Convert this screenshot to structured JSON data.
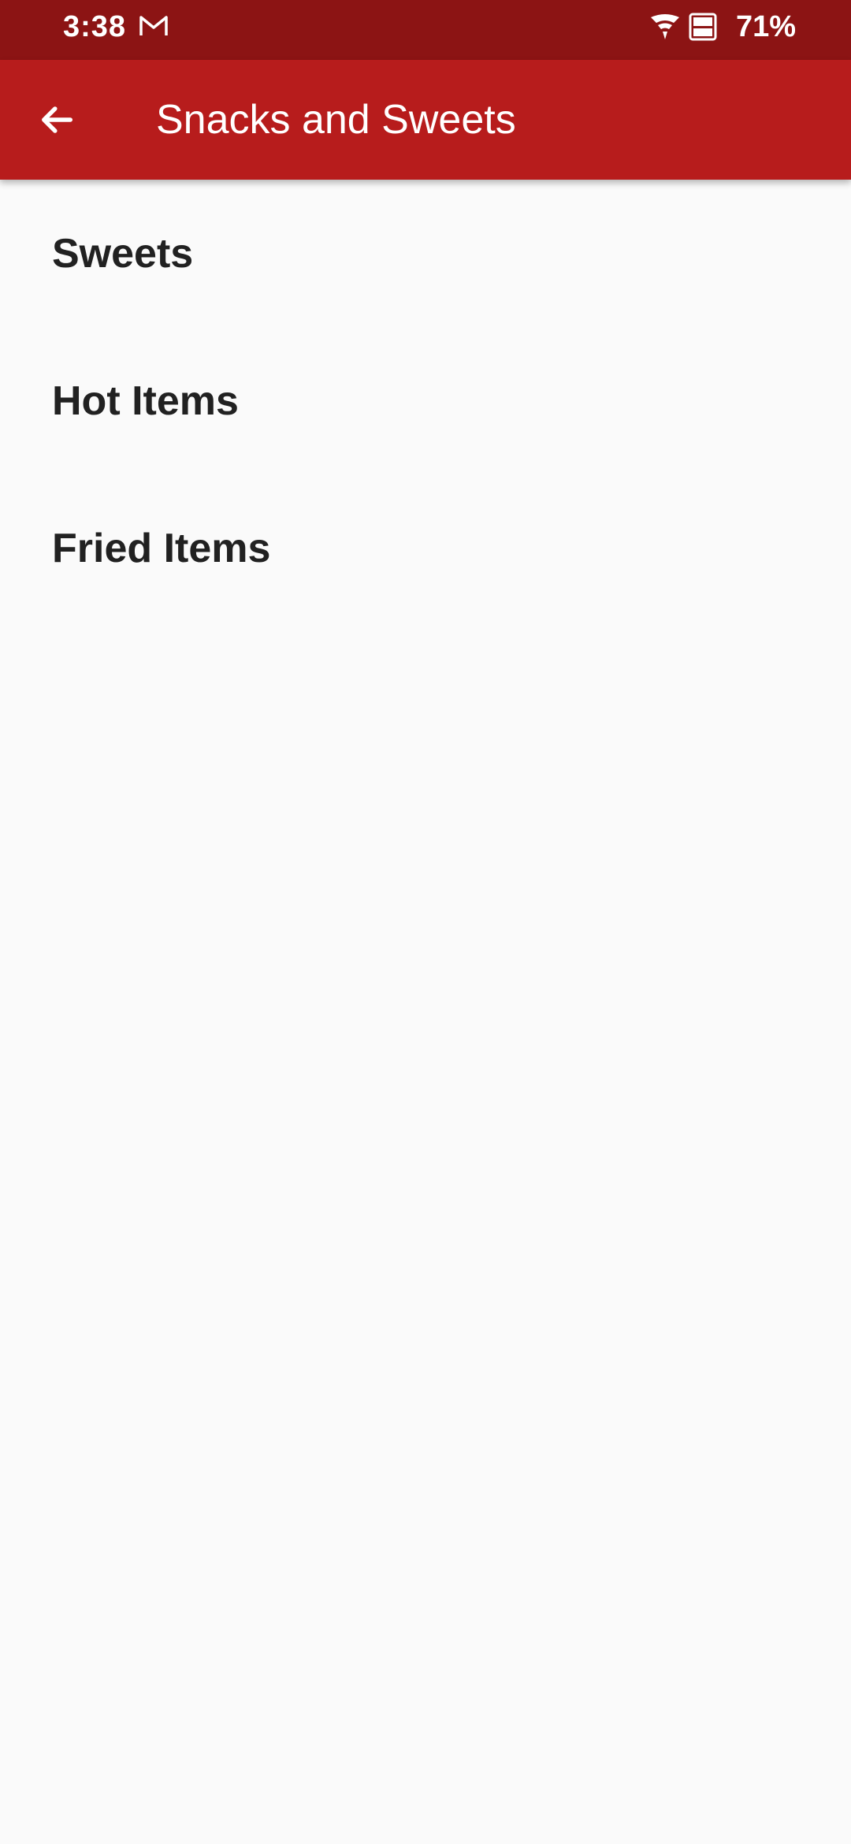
{
  "status_bar": {
    "time": "3:38",
    "battery": "71%",
    "notification_icon": "gmail-icon",
    "background_color": "#8c1414"
  },
  "app_bar": {
    "title": "Snacks and Sweets",
    "back_icon": "arrow-back-icon",
    "background_color": "#b71c1c"
  },
  "categories": [
    {
      "label": "Sweets"
    },
    {
      "label": "Hot Items"
    },
    {
      "label": "Fried Items"
    }
  ]
}
